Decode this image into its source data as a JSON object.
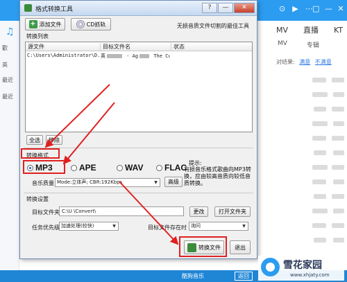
{
  "background_app": {
    "window_controls": [
      "□",
      "—",
      "✕"
    ],
    "player_controls": [
      "⊙",
      "▶",
      "⋯"
    ],
    "tabs": [
      "MV",
      "直播",
      "KT"
    ],
    "subtabs": [
      "MV",
      "专辑"
    ],
    "results_label": "对结果:",
    "results_links": [
      "满意",
      "不满意"
    ],
    "sidebar_items": [
      "歡",
      "英",
      "最近",
      "最近"
    ],
    "bottom_text": "酷狗音乐",
    "bottom_right": "返回"
  },
  "dialog": {
    "title": "格式转换工具",
    "window_buttons": [
      "?",
      "—",
      "✕"
    ],
    "add_file_label": "添加文件",
    "cd_rip_label": "CD抓轨",
    "slogan": "无损音质文件切割的最佳工具",
    "list_section_label": "转换列表",
    "list_columns": [
      "源文件",
      "目标文件名",
      "状态"
    ],
    "list_rows": [
      {
        "source": "C:\\Users\\Administrator\\D...",
        "target_prefix": "英",
        "target_mid": " - Ag",
        "target_suffix": " The Cur...",
        "status": ""
      }
    ],
    "select_all_label": "全选",
    "remove_label": "移除",
    "format_section_label": "转换格式",
    "formats": [
      {
        "label": "MP3",
        "selected": true
      },
      {
        "label": "APE",
        "selected": false
      },
      {
        "label": "WAV",
        "selected": false
      },
      {
        "label": "FLAC",
        "selected": false
      }
    ],
    "tip_title": "提示:",
    "tip_text": "有损音乐格式歌曲向MP3转换，应由较高音质向较低音质转换。",
    "quality_label": "音乐质量",
    "quality_value": "Mode:立体声; CBR:192Kbps",
    "advanced_label": "高级",
    "settings_section_label": "转换设置",
    "target_folder_label": "目标文件夹",
    "target_folder_value": "C:\\U         \\Convert\\",
    "change_label": "更改",
    "open_folder_label": "打开文件夹",
    "priority_label": "任务优先级",
    "priority_value": "加速处理(较快)",
    "exists_label": "目标文件存在时",
    "exists_value": "询问",
    "convert_label": "转换文件",
    "exit_label": "退出"
  },
  "watermark": {
    "name": "雪花家园",
    "url": "www.xhjaty.com"
  },
  "colors": {
    "accent_blue": "#2b9cf0",
    "annotation_red": "#e02020",
    "dialog_bg": "#f0f0f0"
  }
}
